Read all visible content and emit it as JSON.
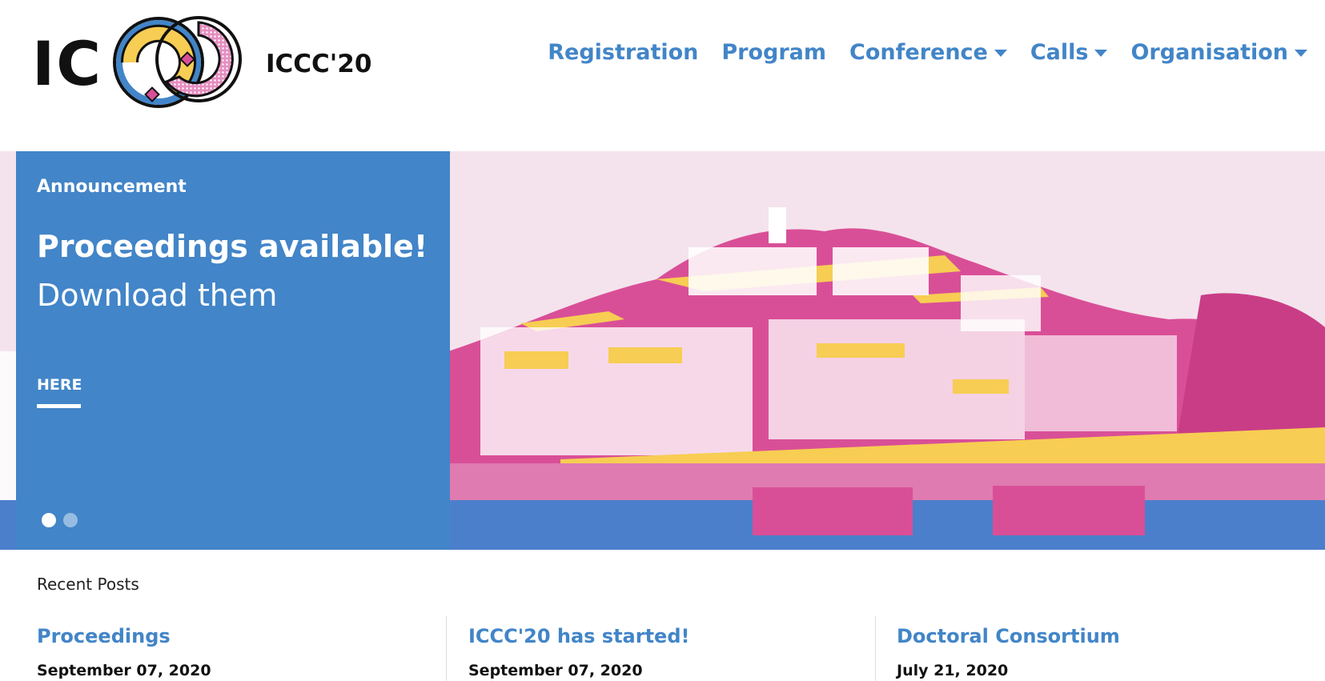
{
  "brand": {
    "logo_letters": "IC",
    "wordmark": "ICCC'20"
  },
  "nav": {
    "items": [
      {
        "label": "Registration",
        "dropdown": false
      },
      {
        "label": "Program",
        "dropdown": false
      },
      {
        "label": "Conference",
        "dropdown": true
      },
      {
        "label": "Calls",
        "dropdown": true
      },
      {
        "label": "Organisation",
        "dropdown": true
      }
    ]
  },
  "hero": {
    "kicker": "Announcement",
    "title": "Proceedings available!",
    "subtitle": "Download them",
    "link_label": "HERE",
    "slides_total": 2,
    "active_slide": 1
  },
  "recent": {
    "heading": "Recent Posts",
    "posts": [
      {
        "title": "Proceedings",
        "date": "September 07, 2020"
      },
      {
        "title": "ICCC'20 has started!",
        "date": "September 07, 2020"
      },
      {
        "title": "Doctoral Consortium",
        "date": "July 21, 2020"
      }
    ]
  },
  "colors": {
    "accent_blue": "#4285c8",
    "accent_pink": "#d94f97",
    "accent_yellow": "#f7cd53"
  }
}
